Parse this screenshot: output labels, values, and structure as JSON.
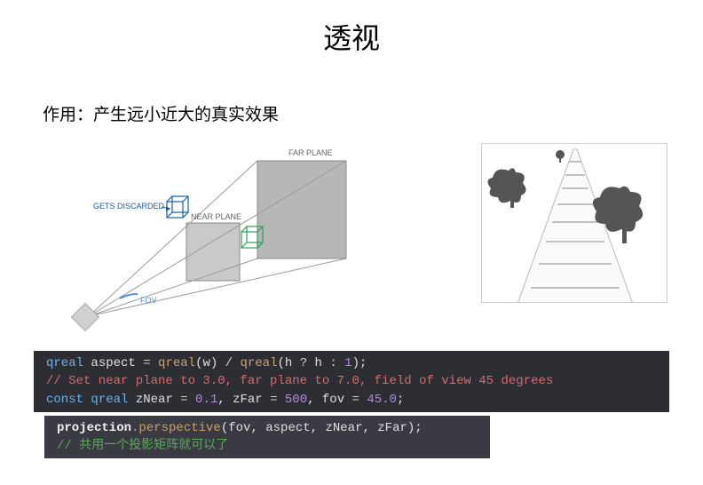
{
  "title": "透视",
  "subtitle": "作用：产生远小近大的真实效果",
  "frustum": {
    "far_plane": "FAR PLANE",
    "near_plane": "NEAR PLANE",
    "gets_discarded": "GETS DISCARDED",
    "fov": "FOV"
  },
  "code1": {
    "l1": {
      "t1": "qreal",
      "t2": " aspect ",
      "t3": "=",
      "t4": " qreal",
      "t5": "(w) ",
      "t6": "/",
      "t7": " qreal",
      "t8": "(h ",
      "t9": "?",
      "t10": " h ",
      "t11": ":",
      "t12": " 1",
      "t13": ");"
    },
    "l2": "// Set near plane to 3.0, far plane to 7.0, field of view 45 degrees",
    "l3": {
      "t1": "const",
      "t2": " qreal",
      "t3": " zNear ",
      "t4": "=",
      "t5": " 0.1",
      "t6": ", zFar ",
      "t7": "=",
      "t8": " 500",
      "t9": ", fov ",
      "t10": "=",
      "t11": " 45.0",
      "t12": ";"
    }
  },
  "code2": {
    "l1": {
      "t1": "projection",
      "t2": ".perspective",
      "t3": "(fov, aspect, zNear, zFar);"
    },
    "l2": "// 共用一个投影矩阵就可以了"
  }
}
